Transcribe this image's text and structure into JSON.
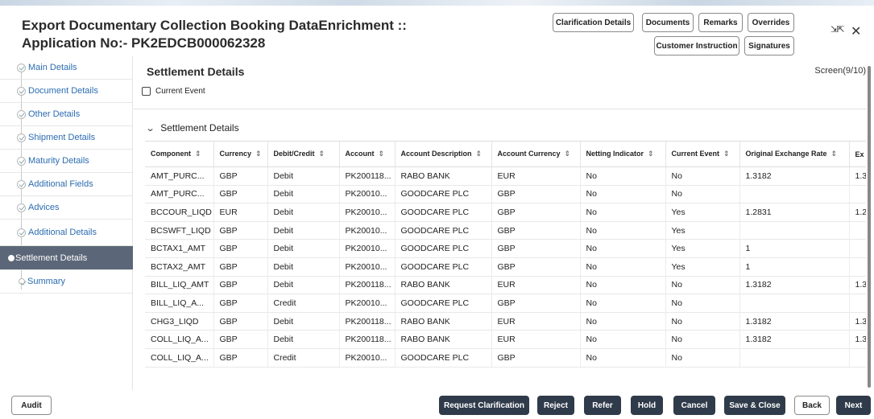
{
  "header": {
    "title": "Export Documentary Collection Booking DataEnrichment :: Application No:- PK2EDCB000062328",
    "buttons": {
      "clarification_details": "Clarification Details",
      "documents": "Documents",
      "remarks": "Remarks",
      "overrides": "Overrides",
      "customer_instruction": "Customer Instruction",
      "signatures": "Signatures"
    },
    "icons": {
      "collapse": "collapse-arrows-icon",
      "close": "close-icon"
    }
  },
  "sidebar": {
    "items": [
      {
        "label": "Main Details",
        "state": "done"
      },
      {
        "label": "Document Details",
        "state": "done"
      },
      {
        "label": "Other Details",
        "state": "done"
      },
      {
        "label": "Shipment Details",
        "state": "done"
      },
      {
        "label": "Maturity Details",
        "state": "done"
      },
      {
        "label": "Additional Fields",
        "state": "done"
      },
      {
        "label": "Advices",
        "state": "done"
      },
      {
        "label": "Additional Details",
        "state": "done"
      },
      {
        "label": "Settlement Details",
        "state": "active"
      },
      {
        "label": "Summary",
        "state": "pending"
      }
    ]
  },
  "main": {
    "section_title": "Settlement Details",
    "screen_count": "Screen(9/10)",
    "current_event_label": "Current Event",
    "current_event_checked": false,
    "panel_title": "Settlement Details"
  },
  "table": {
    "columns": [
      "Component",
      "Currency",
      "Debit/Credit",
      "Account",
      "Account Description",
      "Account Currency",
      "Netting Indicator",
      "Current Event",
      "Original Exchange Rate",
      "Ex"
    ],
    "rows": [
      [
        "AMT_PURC...",
        "GBP",
        "Debit",
        "PK200118...",
        "RABO BANK",
        "EUR",
        "No",
        "No",
        "1.3182",
        "1.3"
      ],
      [
        "AMT_PURC...",
        "GBP",
        "Debit",
        "PK20010...",
        "GOODCARE PLC",
        "GBP",
        "No",
        "No",
        "",
        ""
      ],
      [
        "BCCOUR_LIQD",
        "EUR",
        "Debit",
        "PK20010...",
        "GOODCARE PLC",
        "GBP",
        "No",
        "Yes",
        "1.2831",
        "1.2"
      ],
      [
        "BCSWFT_LIQD",
        "GBP",
        "Debit",
        "PK20010...",
        "GOODCARE PLC",
        "GBP",
        "No",
        "Yes",
        "",
        ""
      ],
      [
        "BCTAX1_AMT",
        "GBP",
        "Debit",
        "PK20010...",
        "GOODCARE PLC",
        "GBP",
        "No",
        "Yes",
        "1",
        ""
      ],
      [
        "BCTAX2_AMT",
        "GBP",
        "Debit",
        "PK20010...",
        "GOODCARE PLC",
        "GBP",
        "No",
        "Yes",
        "1",
        ""
      ],
      [
        "BILL_LIQ_AMT",
        "GBP",
        "Debit",
        "PK200118...",
        "RABO BANK",
        "EUR",
        "No",
        "No",
        "1.3182",
        "1.3"
      ],
      [
        "BILL_LIQ_A...",
        "GBP",
        "Credit",
        "PK20010...",
        "GOODCARE PLC",
        "GBP",
        "No",
        "No",
        "",
        ""
      ],
      [
        "CHG3_LIQD",
        "GBP",
        "Debit",
        "PK200118...",
        "RABO BANK",
        "EUR",
        "No",
        "No",
        "1.3182",
        "1.3"
      ],
      [
        "COLL_LIQ_A...",
        "GBP",
        "Debit",
        "PK200118...",
        "RABO BANK",
        "EUR",
        "No",
        "No",
        "1.3182",
        "1.3"
      ],
      [
        "COLL_LIQ_A...",
        "GBP",
        "Credit",
        "PK20010...",
        "GOODCARE PLC",
        "GBP",
        "No",
        "No",
        "",
        ""
      ]
    ]
  },
  "footer": {
    "audit": "Audit",
    "request_clarification": "Request Clarification",
    "reject": "Reject",
    "refer": "Refer",
    "hold": "Hold",
    "cancel": "Cancel",
    "save_close": "Save & Close",
    "back": "Back",
    "next": "Next"
  }
}
